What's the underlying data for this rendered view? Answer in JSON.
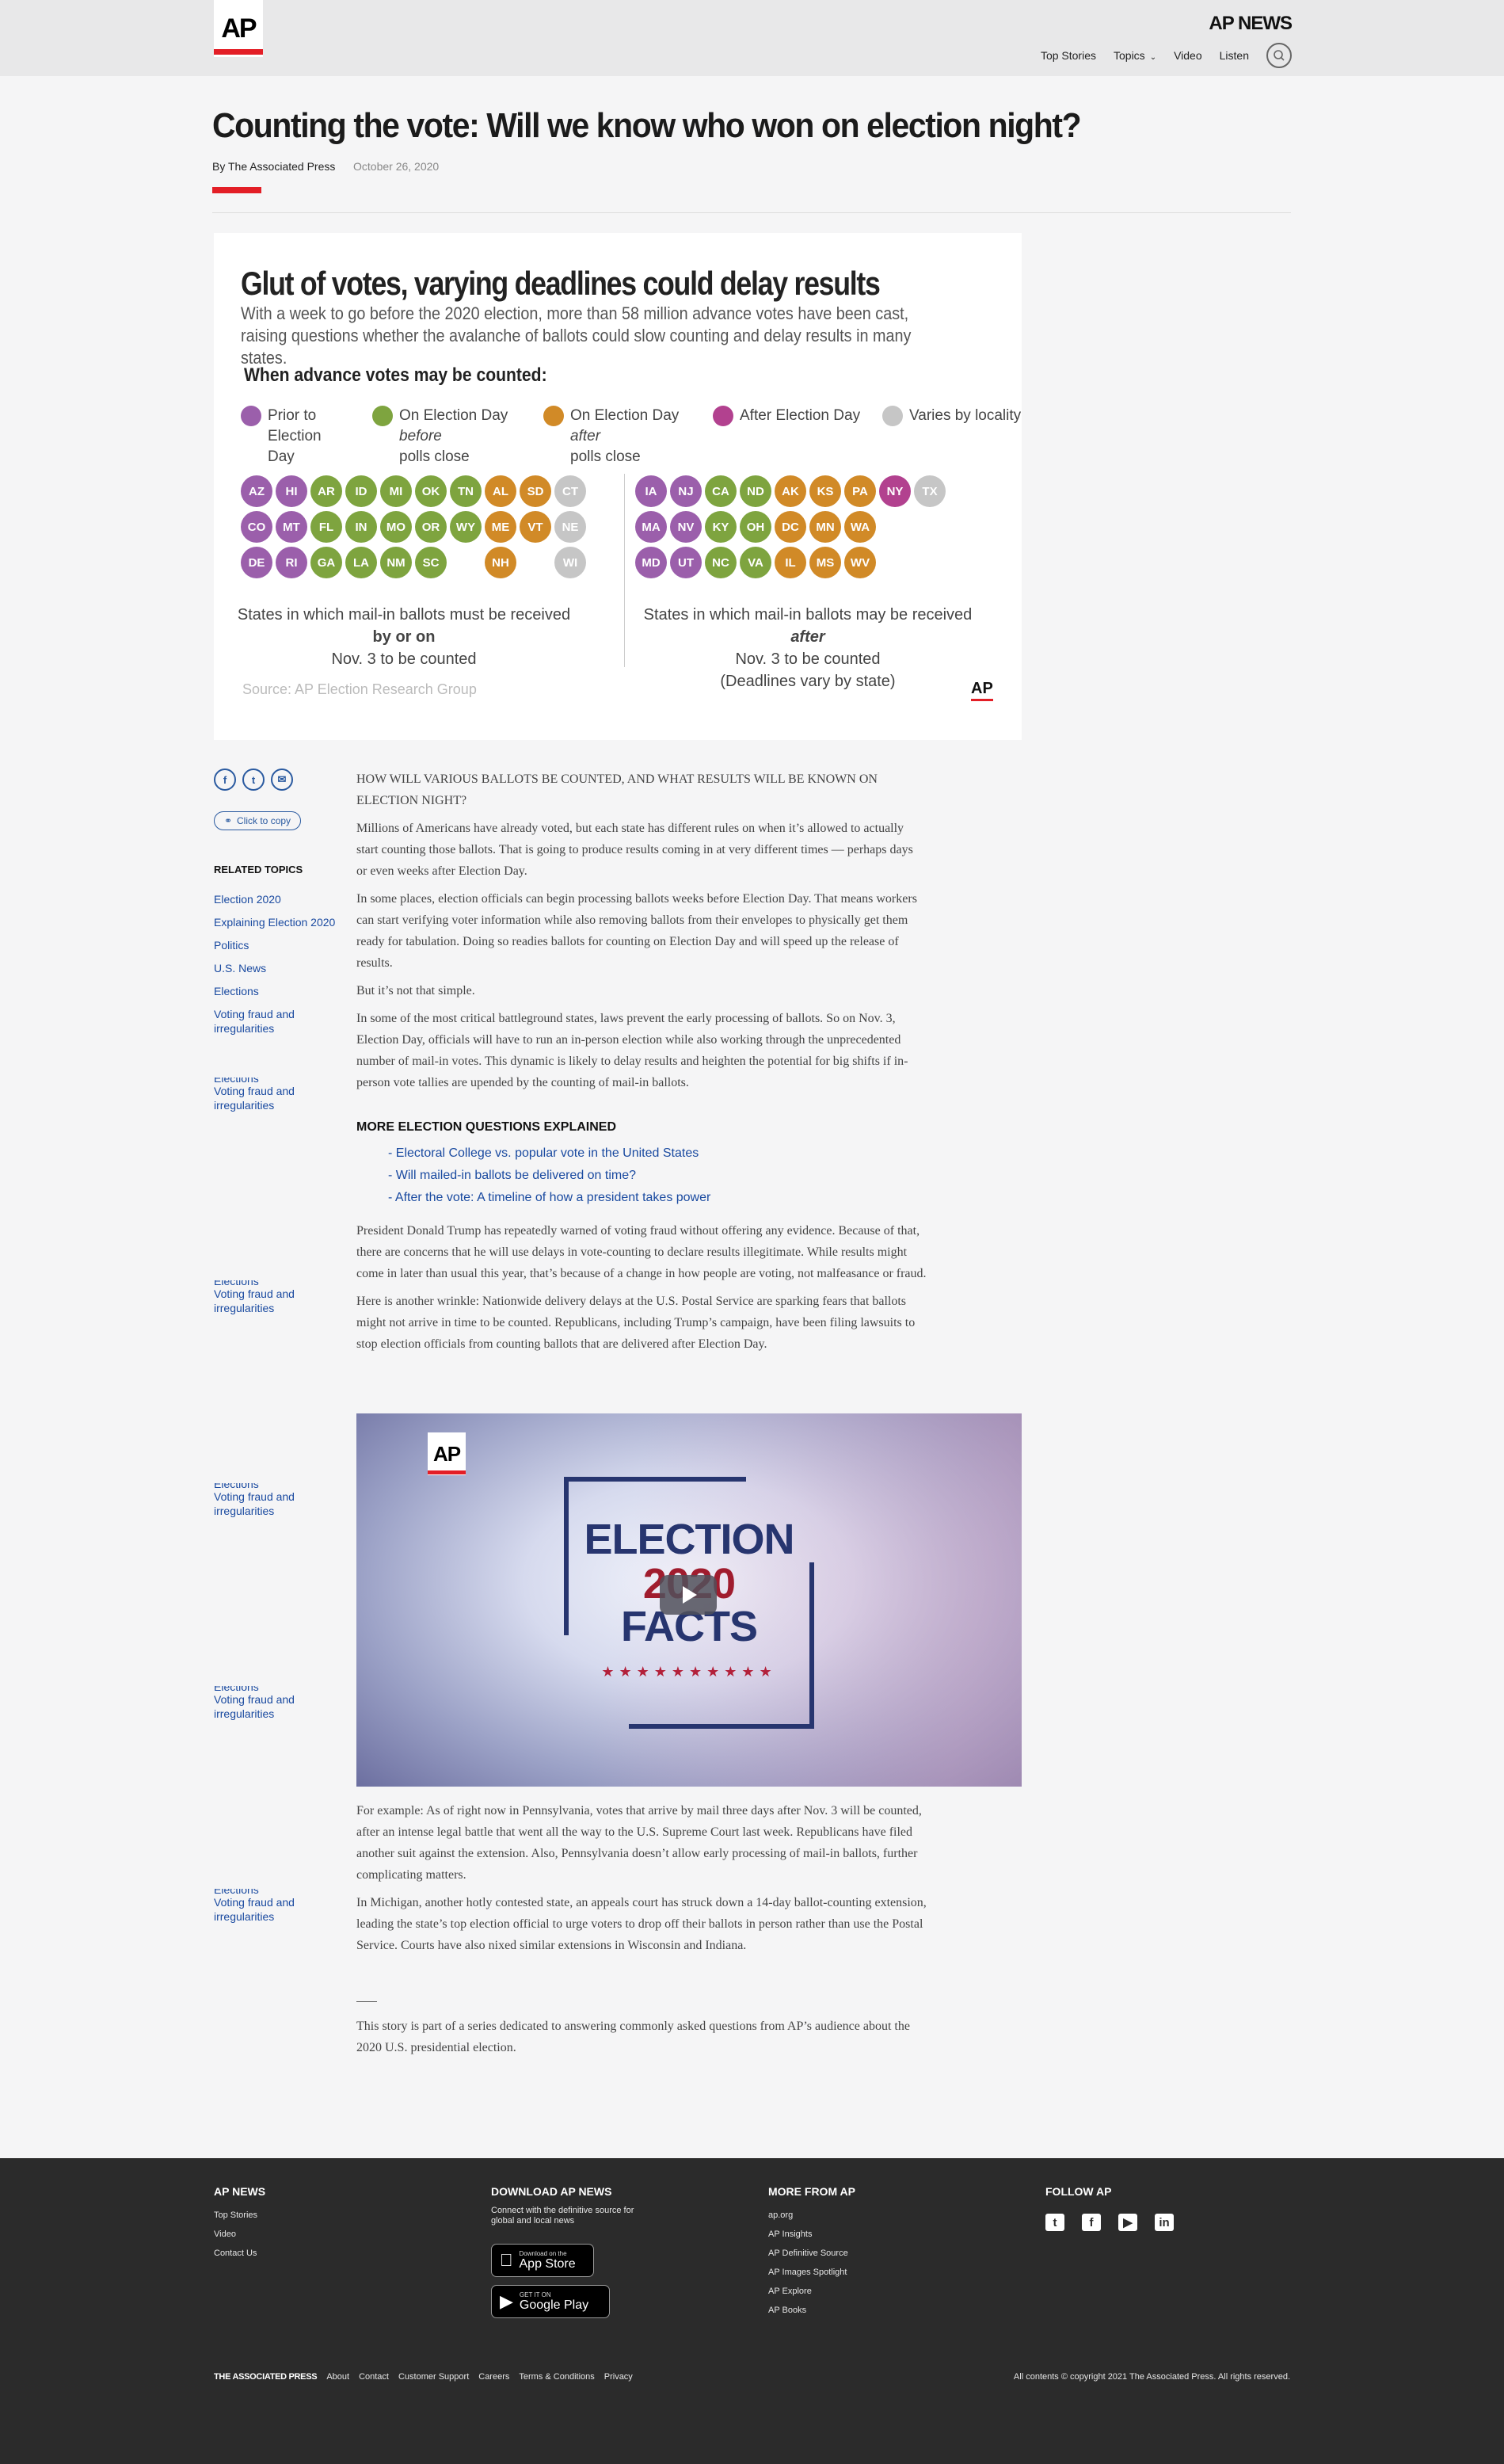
{
  "site": {
    "logo": "AP",
    "name": "AP NEWS"
  },
  "nav": {
    "items": [
      "Top Stories",
      "Topics",
      "Video",
      "Listen"
    ]
  },
  "article": {
    "title": "Counting the vote: Will we know who won on election night?",
    "byline": "By The Associated Press",
    "date": "October 26, 2020"
  },
  "graphic": {
    "title": "Glut of votes, varying deadlines could delay results",
    "subtitle": "With a week to go before the 2020 election, more than 58 million advance votes have been cast, raising questions whether the avalanche of ballots could slow counting and delay results in many states.",
    "when_heading": "When advance votes may be counted:",
    "legend": [
      {
        "key": "prior",
        "label1": "Prior to Election",
        "label2": "Day",
        "color": "#9b5fab"
      },
      {
        "key": "before",
        "label1a": "On Election Day ",
        "label1b": "before",
        "label2": "polls close",
        "color": "#7ea43f"
      },
      {
        "key": "after",
        "label1a": "On Election Day ",
        "label1b": "after",
        "label2": "polls close",
        "color": "#d18a27"
      },
      {
        "key": "afterday",
        "label1": "After Election Day",
        "label2": "",
        "color": "#b2418f"
      },
      {
        "key": "varies",
        "label1": "Varies by locality",
        "label2": "",
        "color": "#c6c6c6"
      }
    ],
    "colors": {
      "P": "#9b5fab",
      "G": "#7ea43f",
      "O": "#d18a27",
      "M": "#b2418f",
      "X": "#c6c6c6",
      "E": "transparent"
    },
    "left_states": [
      [
        "AZ",
        "P"
      ],
      [
        "HI",
        "P"
      ],
      [
        "AR",
        "G"
      ],
      [
        "ID",
        "G"
      ],
      [
        "MI",
        "G"
      ],
      [
        "OK",
        "G"
      ],
      [
        "TN",
        "G"
      ],
      [
        "AL",
        "O"
      ],
      [
        "SD",
        "O"
      ],
      [
        "CT",
        "X"
      ],
      [
        "CO",
        "P"
      ],
      [
        "MT",
        "P"
      ],
      [
        "FL",
        "G"
      ],
      [
        "IN",
        "G"
      ],
      [
        "MO",
        "G"
      ],
      [
        "OR",
        "G"
      ],
      [
        "WY",
        "G"
      ],
      [
        "ME",
        "O"
      ],
      [
        "VT",
        "O"
      ],
      [
        "NE",
        "X"
      ],
      [
        "DE",
        "P"
      ],
      [
        "RI",
        "P"
      ],
      [
        "GA",
        "G"
      ],
      [
        "LA",
        "G"
      ],
      [
        "NM",
        "G"
      ],
      [
        "SC",
        "G"
      ],
      [
        "",
        "E"
      ],
      [
        "NH",
        "O"
      ],
      [
        "",
        "E"
      ],
      [
        "WI",
        "X"
      ]
    ],
    "right_states": [
      [
        "IA",
        "P"
      ],
      [
        "NJ",
        "P"
      ],
      [
        "CA",
        "G"
      ],
      [
        "ND",
        "G"
      ],
      [
        "AK",
        "O"
      ],
      [
        "KS",
        "O"
      ],
      [
        "PA",
        "O"
      ],
      [
        "NY",
        "M"
      ],
      [
        "TX",
        "X"
      ],
      [
        "MA",
        "P"
      ],
      [
        "NV",
        "P"
      ],
      [
        "KY",
        "G"
      ],
      [
        "OH",
        "G"
      ],
      [
        "DC",
        "O"
      ],
      [
        "MN",
        "O"
      ],
      [
        "WA",
        "O"
      ],
      [
        "",
        "E"
      ],
      [
        "",
        "E"
      ],
      [
        "MD",
        "P"
      ],
      [
        "UT",
        "P"
      ],
      [
        "NC",
        "G"
      ],
      [
        "VA",
        "G"
      ],
      [
        "IL",
        "O"
      ],
      [
        "MS",
        "O"
      ],
      [
        "WV",
        "O"
      ],
      [
        "",
        "E"
      ],
      [
        "",
        "E"
      ]
    ],
    "caption_left_1": "States in which mail-in ballots must be received ",
    "caption_left_bold": "by or on",
    "caption_left_2": "Nov. 3 to be counted",
    "caption_right_1": "States in which mail-in ballots may be received ",
    "caption_right_bold": "after",
    "caption_right_2": "Nov. 3 to be counted",
    "caption_right_3": "(Deadlines vary by state)",
    "source": "Source: AP Election Research Group",
    "credit": "AP"
  },
  "share": {
    "copy_label": "Click to copy"
  },
  "related": {
    "heading": "RELATED TOPICS",
    "items": [
      "Election 2020",
      "Explaining Election 2020",
      "Politics",
      "U.S. News",
      "Elections",
      "Voting fraud and irregularities"
    ],
    "ghost_cut": "Elections",
    "ghost_link": "Voting fraud and irregularities"
  },
  "body": {
    "p1": "HOW WILL VARIOUS BALLOTS BE COUNTED, AND WHAT RESULTS WILL BE KNOWN ON ELECTION NIGHT?",
    "p2": "Millions of Americans have already voted, but each state has different rules on when it’s allowed to actually start counting those ballots. That is going to produce results coming in at very different times — perhaps days or even weeks after Election Day.",
    "p3": "In some places, election officials can begin processing ballots weeks before Election Day. That means workers can start verifying voter information while also removing ballots from their envelopes to physically get them ready for tabulation. Doing so readies ballots for counting on Election Day and will speed up the release of results.",
    "p4": "But it’s not that simple.",
    "p5": "In some of the most critical battleground states, laws prevent the early processing of ballots. So on Nov. 3, Election Day, officials will have to run an in-person election while also working through the unprecedented number of mail-in votes. This dynamic is likely to delay results and heighten the potential for big shifts if in-person vote tallies are upended by the counting of mail-in ballots.",
    "more_heading": "MORE ELECTION QUESTIONS EXPLAINED",
    "more_links": [
      "- Electoral College vs. popular vote in the United States",
      "- Will mailed-in ballots be delivered on time?",
      "- After the vote: A timeline of how a president takes power"
    ],
    "p6": "President Donald Trump has repeatedly warned of voting fraud without offering any evidence. Because of that, there are concerns that he will use delays in vote-counting to declare results illegitimate. While results might come in later than usual this year, that’s because of a change in how people are voting, not malfeasance or fraud.",
    "p7": "Here is another wrinkle: Nationwide delivery delays at the U.S. Postal Service are sparking fears that ballots might not arrive in time to be counted. Republicans, including Trump’s campaign, have been filing lawsuits to stop election officials from counting ballots that are delivered after Election Day.",
    "p8": "For example: As of right now in Pennsylvania, votes that arrive by mail three days after Nov. 3 will be counted, after an intense legal battle that went all the way to the U.S. Supreme Court last week. Republicans have filed another suit against the extension. Also, Pennsylvania doesn’t allow early processing of mail-in ballots, further complicating matters.",
    "p9": "In Michigan, another hotly contested state, an appeals court has struck down a 14-day ballot-counting extension, leading the state’s top election official to urge voters to drop off their ballots in person rather than use the Postal Service. Courts have also nixed similar extensions in Wisconsin and Indiana.",
    "p10": "This story is part of a series dedicated to answering commonly asked questions from AP’s audience about the 2020 U.S. presidential election."
  },
  "video": {
    "logo": "AP",
    "line1": "ELECTION",
    "line2": "2020",
    "line3": "FACTS",
    "stars": "★★★★★★★★★★"
  },
  "footer": {
    "col1": {
      "heading": "AP NEWS",
      "links": [
        "Top Stories",
        "Video",
        "Contact Us"
      ]
    },
    "col2": {
      "heading": "DOWNLOAD AP NEWS",
      "desc": "Connect with the definitive source for global and local news",
      "appstore_small": "Download on the",
      "appstore_big": "App Store",
      "play_small": "GET IT ON",
      "play_big": "Google Play"
    },
    "col3": {
      "heading": "MORE FROM AP",
      "links": [
        "ap.org",
        "AP Insights",
        "AP Definitive Source",
        "AP Images Spotlight",
        "AP Explore",
        "AP Books"
      ]
    },
    "col4": {
      "heading": "FOLLOW AP"
    },
    "bottom_brand": "THE ASSOCIATED PRESS",
    "bottom_links": [
      "About",
      "Contact",
      "Customer Support",
      "Careers",
      "Terms & Conditions",
      "Privacy"
    ],
    "copyright": "All contents © copyright 2021 The Associated Press. All rights reserved."
  }
}
